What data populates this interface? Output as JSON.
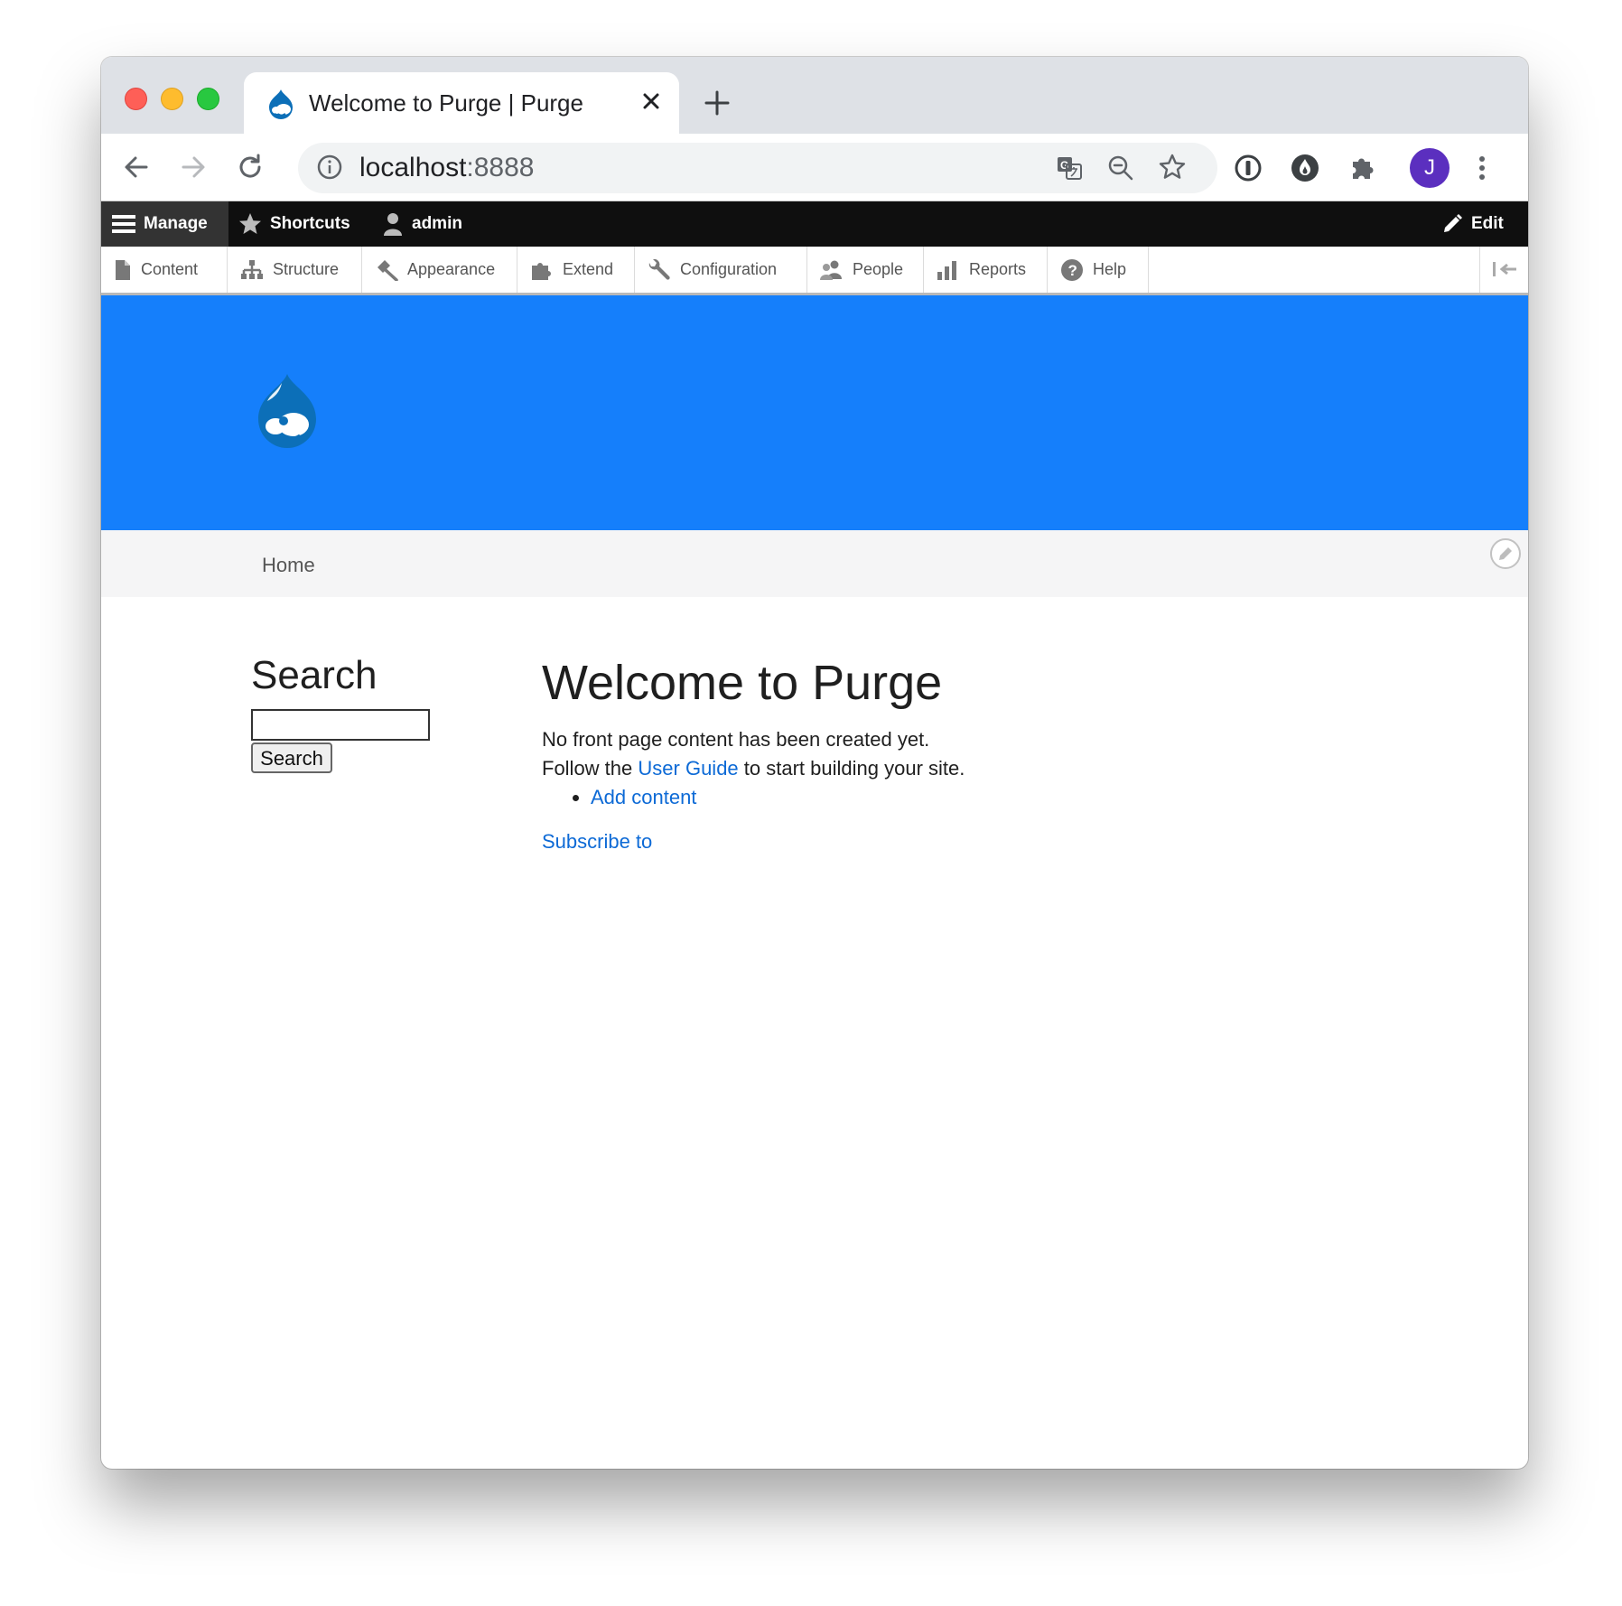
{
  "browser": {
    "tab": {
      "title": "Welcome to Purge | Purge",
      "favicon": "drupal-drop-icon"
    },
    "url": {
      "host": "localhost",
      "port": ":8888"
    },
    "profile_initial": "J",
    "colors": {
      "avatar": "#5b2fbf",
      "tabstrip": "#dee1e6"
    }
  },
  "admin_toolbar": {
    "manage": "Manage",
    "shortcuts": "Shortcuts",
    "user": "admin",
    "edit": "Edit"
  },
  "admin_tray": {
    "items": [
      {
        "label": "Content",
        "icon": "document-icon"
      },
      {
        "label": "Structure",
        "icon": "hierarchy-icon"
      },
      {
        "label": "Appearance",
        "icon": "brush-icon"
      },
      {
        "label": "Extend",
        "icon": "puzzle-icon"
      },
      {
        "label": "Configuration",
        "icon": "wrench-icon"
      },
      {
        "label": "People",
        "icon": "people-icon"
      },
      {
        "label": "Reports",
        "icon": "bar-chart-icon"
      },
      {
        "label": "Help",
        "icon": "help-icon"
      }
    ]
  },
  "site": {
    "header_color": "#157ffb",
    "breadcrumb": "Home"
  },
  "sidebar": {
    "title": "Search",
    "search_value": "",
    "search_button": "Search"
  },
  "main": {
    "title": "Welcome to Purge",
    "line1": "No front page content has been created yet.",
    "line2_prefix": "Follow the ",
    "line2_link": "User Guide",
    "line2_suffix": " to start building your site.",
    "list": [
      "Add content"
    ],
    "subscribe": "Subscribe to"
  }
}
